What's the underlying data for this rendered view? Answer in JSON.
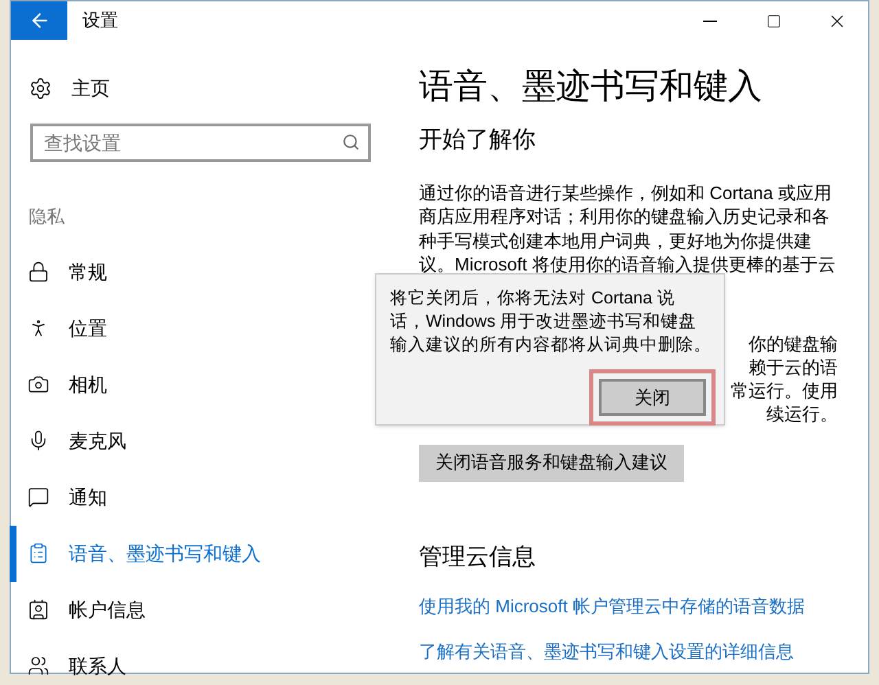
{
  "window": {
    "title": "设置"
  },
  "sidebar": {
    "home": "主页",
    "search": {
      "placeholder": "查找设置"
    },
    "section": "隐私",
    "items": [
      {
        "label": "常规",
        "selected": false
      },
      {
        "label": "位置",
        "selected": false
      },
      {
        "label": "相机",
        "selected": false
      },
      {
        "label": "麦克风",
        "selected": false
      },
      {
        "label": "通知",
        "selected": false
      },
      {
        "label": "语音、墨迹书写和键入",
        "selected": true
      },
      {
        "label": "帐户信息",
        "selected": false
      },
      {
        "label": "联系人",
        "selected": false
      }
    ]
  },
  "main": {
    "title": "语音、墨迹书写和键入",
    "section_1": "开始了解你",
    "paragraph_lines": [
      "通过你的语音进行某些操作，例如和 Cortana 或应用",
      "商店应用程序对话；利用你的键盘输入历史记录和各",
      "种手写模式创建本地用户词典，更好地为你提供建",
      "议。Microsoft 将使用你的语音输入提供更棒的基于云"
    ],
    "hidden_fragments": [
      "你的键盘输",
      "赖于云的语",
      "常运行。使用",
      "续运行。"
    ],
    "turn_off_button": "关闭语音服务和键盘输入建议",
    "section_2": "管理云信息",
    "links": [
      "使用我的 Microsoft 帐户管理云中存储的语音数据",
      "了解有关语音、墨迹书写和键入设置的详细信息"
    ]
  },
  "popup": {
    "lines": [
      "将它关闭后，你将无法对 Cortana 说",
      "话，Windows 用于改进墨迹书写和键盘",
      "输入建议的所有内容都将从词典中删除。"
    ],
    "button": "关闭",
    "highlighted": true
  }
}
